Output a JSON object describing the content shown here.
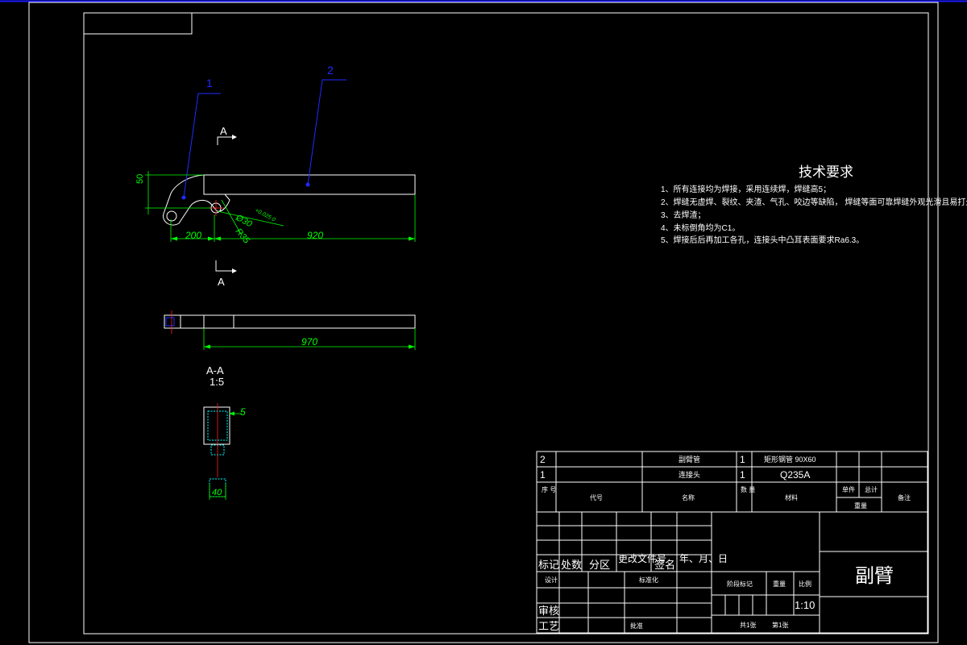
{
  "colors": {
    "background": "#000000",
    "frame": "#ffffff",
    "dimension": "#00ff00",
    "leader": "#1f2bff",
    "centerline": "#ff2020",
    "hatch": "#00ffff",
    "top_border": "#1a1aff"
  },
  "balloons": {
    "part1": "1",
    "part2": "2"
  },
  "section_markers": {
    "top": "A",
    "bottom": "A"
  },
  "dimensions": {
    "height_50": "50",
    "dia": "Ø30",
    "dia_tol": "+0.025\n0",
    "radius": "R35",
    "len_200": "200",
    "len_920": "920",
    "len_970": "970",
    "thick_5": "5",
    "width_40": "40"
  },
  "section_view": {
    "title": "A-A",
    "scale": "1:5"
  },
  "tech_requirements": {
    "title": "技术要求",
    "items": [
      "1、所有连接均为焊接，采用连续焊，焊缝高5；",
      "2、焊缝无虚焊、裂纹、夹渣、气孔、咬边等缺陷，    焊缝等面可靠焊缝外观光滑且易打光。",
      "3、去焊渣；",
      "4、未标倒角均为C1。",
      "5、焊接后后再加工各孔，连接头中凸耳表面要求Ra6.3。"
    ]
  },
  "bom": {
    "rows": [
      {
        "no": "2",
        "name": "副臂管",
        "qty": "1",
        "material": "矩形钢管 90X60"
      },
      {
        "no": "1",
        "name": "连接头",
        "qty": "1",
        "material": "Q235A"
      }
    ],
    "header": {
      "no": "序\n号",
      "code": "代号",
      "name": "名称",
      "qty": "数\n量",
      "material": "材料",
      "unit": "单件",
      "total": "总计",
      "weight": "重量",
      "remark": "备注"
    }
  },
  "title_block": {
    "part_name": "副臂",
    "row_labels": [
      "标记",
      "处数",
      "分区",
      "更改文件号",
      "签名",
      "年、月、日"
    ],
    "design": "设计",
    "standardize": "标准化",
    "review": "审核",
    "process": "工艺",
    "approve": "批准",
    "stage": "阶段标记",
    "weight": "重量",
    "scale_label": "比例",
    "scale": "1:10",
    "sheets_total": "共1张",
    "sheet_no": "第1张"
  }
}
